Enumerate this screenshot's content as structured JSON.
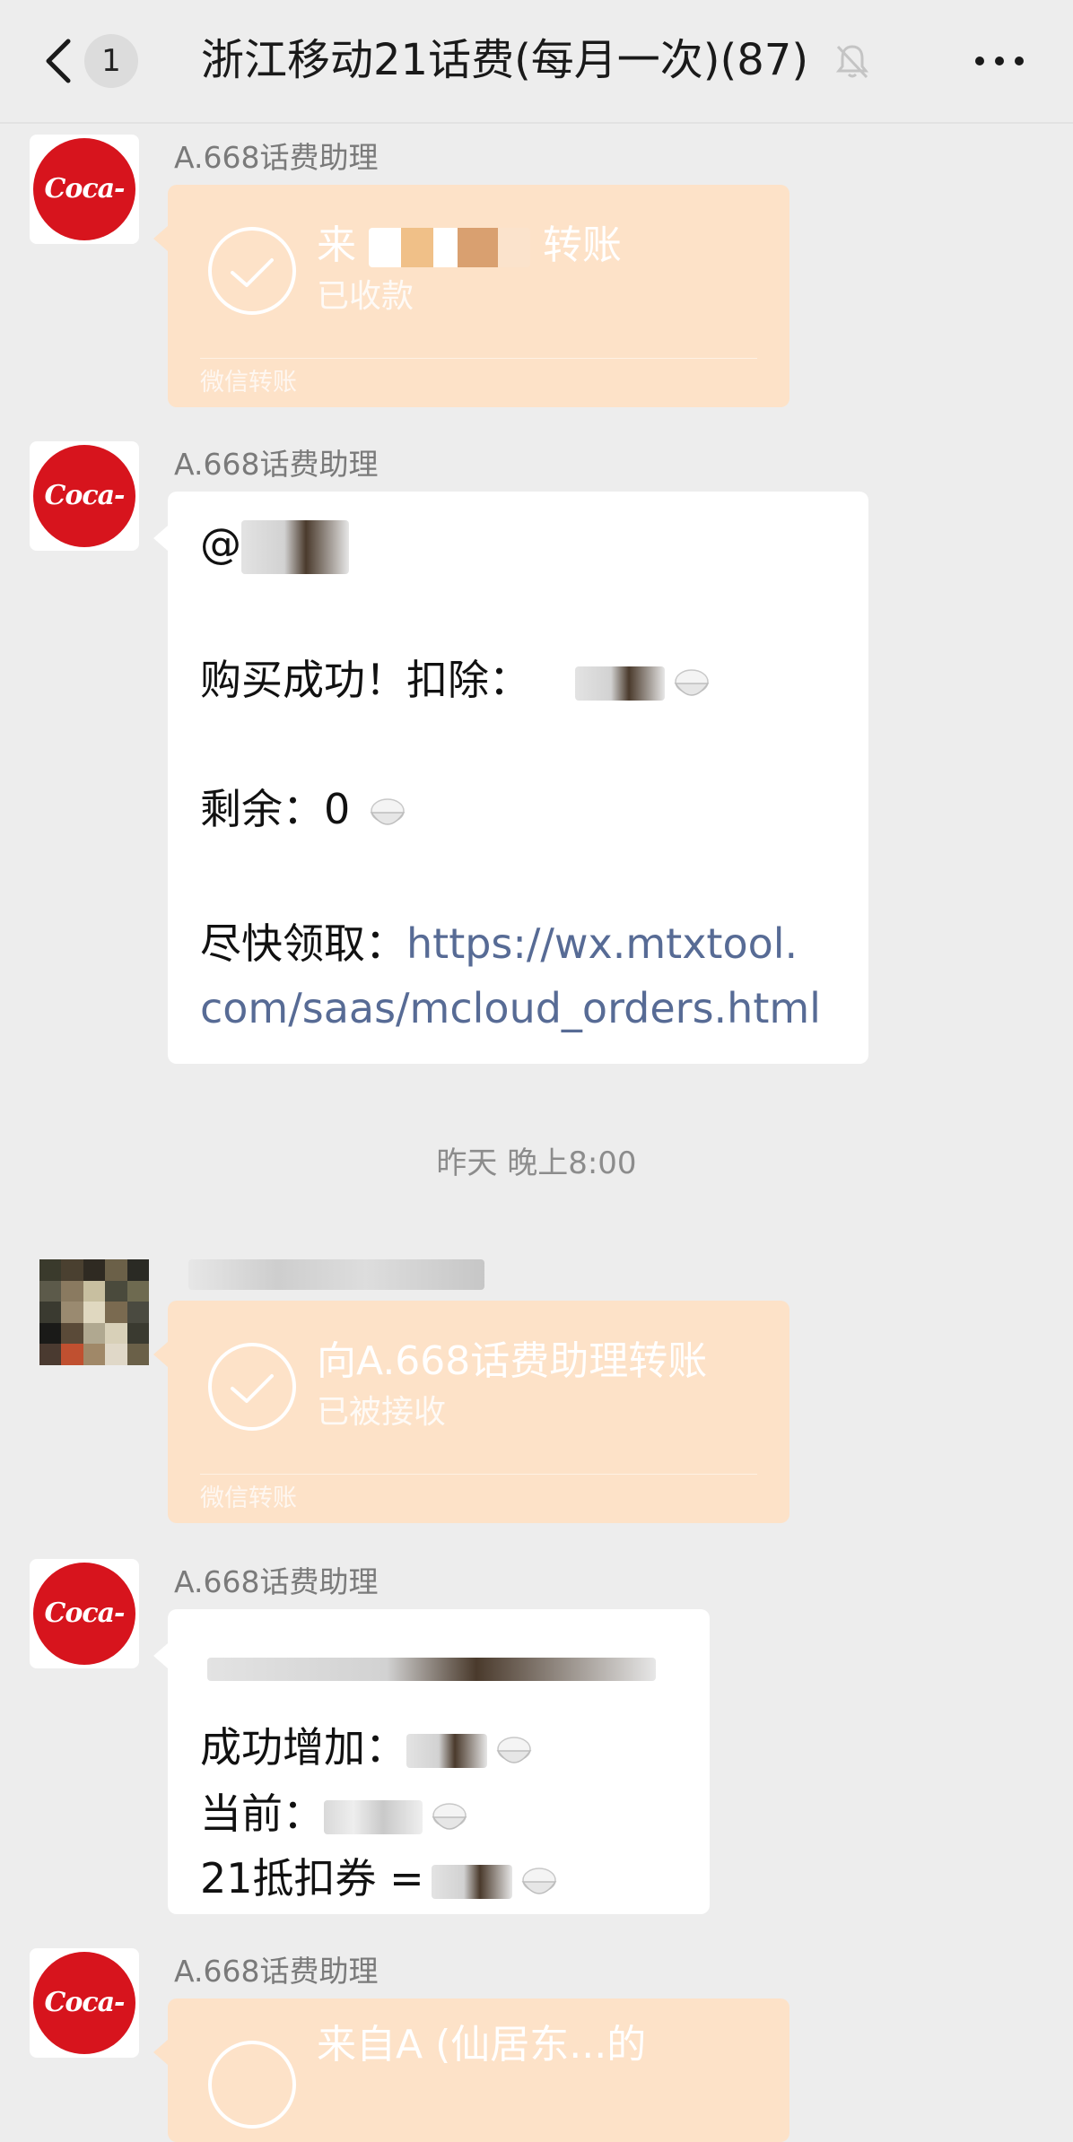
{
  "header": {
    "unread_count": "1",
    "title": "浙江移动21话费(每月一次)(87)"
  },
  "messages": {
    "m1": {
      "sender": "A.668话费助理",
      "transfer_title_prefix": "来",
      "transfer_title_suffix": "转账",
      "transfer_status": "已收款",
      "footer": "微信转账"
    },
    "m2": {
      "sender": "A.668话费助理",
      "at": "@",
      "line1": "购买成功！扣除：",
      "line2": "剩余：0",
      "line3_label": "尽快领取：",
      "link_part1": "https://wx.mtxtool.",
      "link_part2": "com/saas/mcloud_orders.html"
    },
    "time_divider": "昨天 晚上8:00",
    "m3": {
      "transfer_title": "向A.668话费助理转账",
      "transfer_status": "已被接收",
      "footer": "微信转账"
    },
    "m4": {
      "sender": "A.668话费助理",
      "line1": "成功增加：",
      "line2": "当前：",
      "line3": "21抵扣券 ="
    },
    "m5": {
      "sender": "A.668话费助理",
      "transfer_title": "来自A       (仙居东...的"
    }
  }
}
